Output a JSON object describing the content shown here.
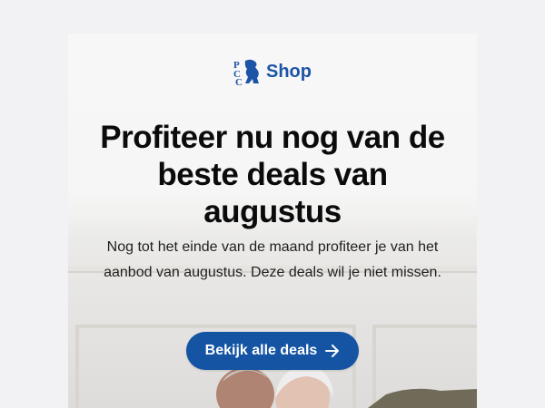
{
  "brand": {
    "name": "Shop",
    "color": "#1d54a6",
    "icon": "pcc-lion-logo"
  },
  "hero": {
    "headline": "Profiteer nu nog van de beste deals van augustus",
    "body": "Nog tot het einde van de maand profiteer je van het aanbod van augustus. Deze deals wil je niet missen."
  },
  "cta": {
    "label": "Bekijk alle deals",
    "icon": "arrow-right-icon",
    "color": "#1454a3"
  }
}
